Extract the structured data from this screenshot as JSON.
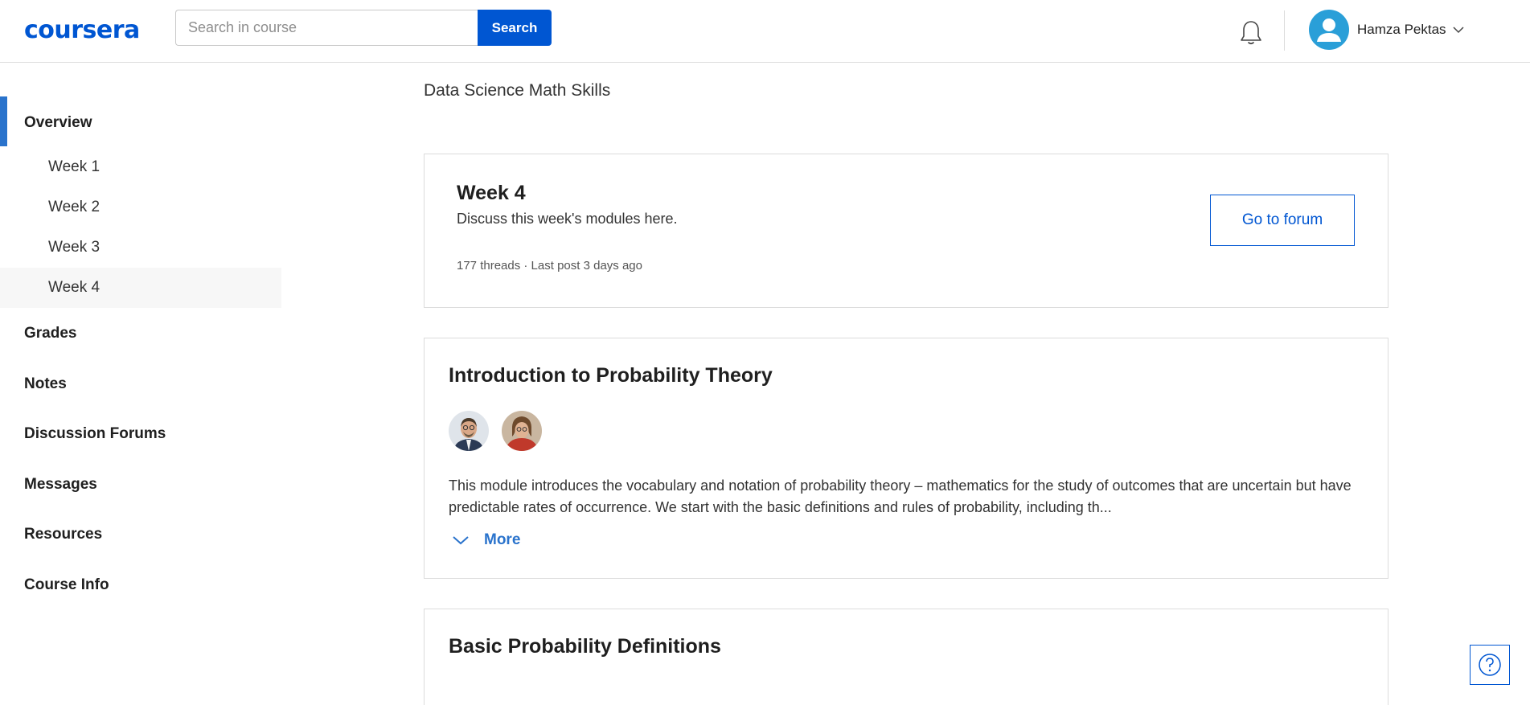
{
  "header": {
    "logo_text": "coursera",
    "search": {
      "placeholder": "Search in course",
      "value": "",
      "button_label": "Search"
    },
    "user_name": "Hamza Pektas"
  },
  "sidebar": {
    "overview": "Overview",
    "weeks": [
      "Week 1",
      "Week 2",
      "Week 3",
      "Week 4"
    ],
    "selected_week": "Week 4",
    "items": [
      "Grades",
      "Notes",
      "Discussion Forums",
      "Messages",
      "Resources",
      "Course Info"
    ]
  },
  "main": {
    "course_title": "Data Science Math Skills",
    "week_card": {
      "title": "Week 4",
      "description": "Discuss this week's modules here.",
      "meta": "177 threads · Last post 3 days ago",
      "button_label": "Go to forum"
    },
    "module_card": {
      "title": "Introduction to Probability Theory",
      "description": "This module introduces the vocabulary and notation of probability theory – mathematics for the study of outcomes that are uncertain but have predictable rates of occurrence. We start with the basic definitions and rules of probability, including th...",
      "more_label": "More"
    },
    "next_card": {
      "title": "Basic Probability Definitions"
    }
  },
  "colors": {
    "brand": "#0056d2",
    "accent": "#2a73cc",
    "avatar": "#2a9fd8"
  },
  "icons": [
    "bell-icon",
    "user-avatar-icon",
    "chevron-down-icon",
    "help-icon"
  ]
}
